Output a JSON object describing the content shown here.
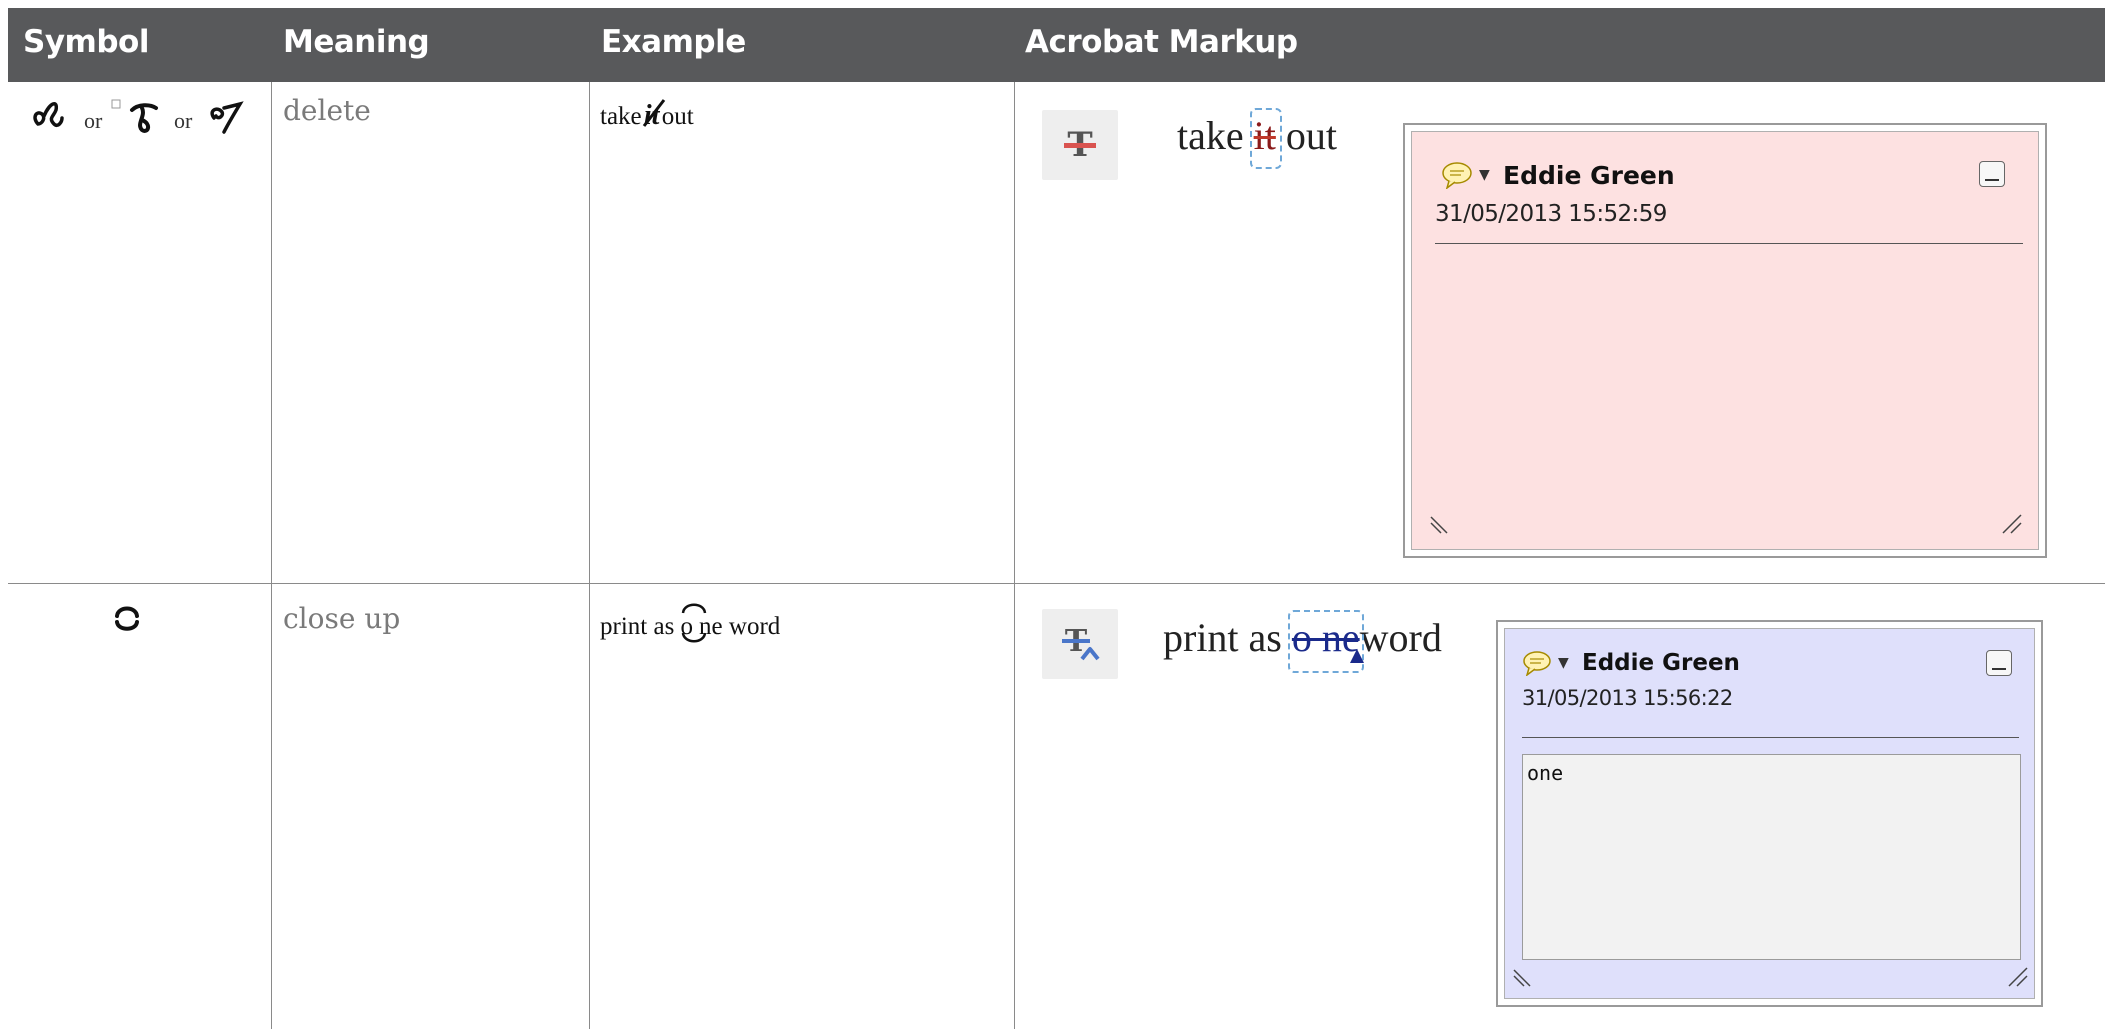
{
  "table": {
    "headers": [
      "Symbol",
      "Meaning",
      "Example",
      "Acrobat Markup"
    ],
    "rows": [
      {
        "symbol_or_1": "or",
        "symbol_or_2": "or",
        "meaning": "delete",
        "example_before": "take",
        "example_struck": "it",
        "example_after": "out",
        "markup_before": "take",
        "markup_struck": "it",
        "markup_after": "out",
        "tool_icon": "strikethrough-text-icon",
        "note": {
          "author": "Eddie Green",
          "date": "31/05/2013 15:52:59",
          "body": "",
          "color": "#fde1e1"
        }
      },
      {
        "meaning": "close up",
        "example_before": "print as",
        "example_o": "o",
        "example_ne": "ne",
        "example_after": "word",
        "markup_before": "print as",
        "markup_struck": "o ne",
        "markup_after": "word",
        "tool_icon": "replace-text-icon",
        "note": {
          "author": "Eddie Green",
          "date": "31/05/2013 15:56:22",
          "body": "one",
          "color": "#dfe0fb"
        }
      }
    ]
  },
  "colors": {
    "header_bg": "#58595b",
    "header_text": "#ffffff",
    "strike_red": "#c0392b",
    "highlight_dash": "#6fa8d8"
  }
}
